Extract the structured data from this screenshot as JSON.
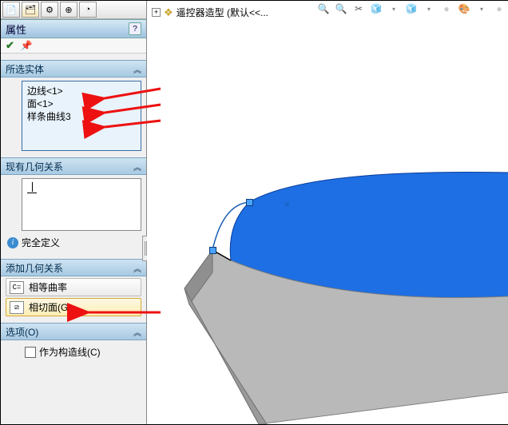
{
  "tabs": {
    "t1": "📄",
    "t2": "🗂",
    "t3": "⚙",
    "t4": "⊕",
    "t5": "◔"
  },
  "title": "属性",
  "okrow": {
    "check": "✔",
    "pin": "📌"
  },
  "section_selected": {
    "title": "所选实体",
    "chev": "︽"
  },
  "selected_items": {
    "0": "边线<1>",
    "1": "面<1>",
    "2": "样条曲线3"
  },
  "section_existing": {
    "title": "现有几何关系",
    "chev": "︽"
  },
  "info": {
    "icon": "i",
    "text": "完全定义"
  },
  "section_add": {
    "title": "添加几何关系",
    "chev": "︽"
  },
  "add_rel": {
    "eq_curv_icon": "C=",
    "eq_curv": "相等曲率",
    "tan_face_icon": "⧄",
    "tan_face": "相切面(G)"
  },
  "section_opt": {
    "title": "选项(O)",
    "chev": "︽"
  },
  "opt": {
    "construction": "作为构造线(C)"
  },
  "vp": {
    "toolbar": {
      "zoom": "🔍",
      "fit": "🔍",
      "section": "✂",
      "iso": "🧊",
      "style": "🧊",
      "dd": "▾",
      "dd2": "▾",
      "grey": "●",
      "pal": "🎨",
      "dd3": "▾",
      "grey2": "●"
    },
    "tree_plus": "+",
    "tree_icon": "❖",
    "tree_text": "遥控器造型 (默认<<...",
    "pt_marker": "×"
  }
}
